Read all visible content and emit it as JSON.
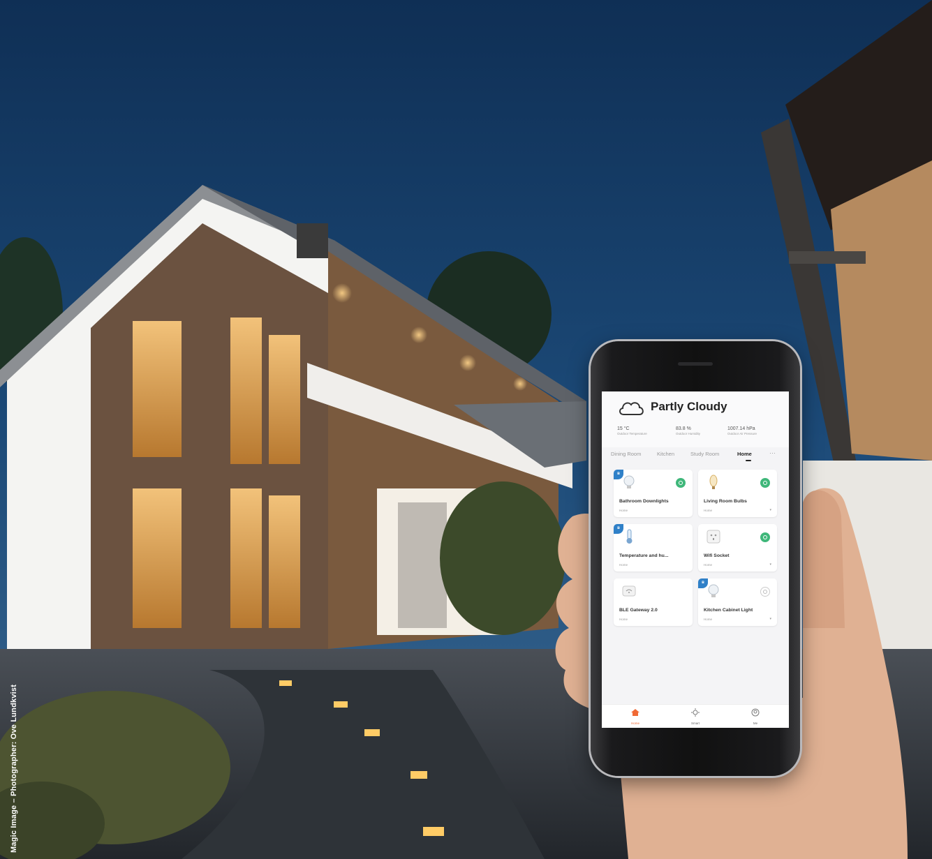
{
  "credit": "Magic Image – Photographer: Ove Lundkvist",
  "app": {
    "weather": {
      "title": "Partly Cloudy",
      "stats": [
        {
          "value": "15 °C",
          "label": "Outdoor Temperature"
        },
        {
          "value": "83.8 %",
          "label": "Outdoor Humidity"
        },
        {
          "value": "1007.14 hPa",
          "label": "Outdoor Air Pressure"
        }
      ]
    },
    "tabs": [
      "Dining Room",
      "Kitchen",
      "Study Room",
      "Home"
    ],
    "active_tab": "Home",
    "more_label": "···",
    "devices": [
      {
        "name": "Bathroom Downlights",
        "room": "Home",
        "icon": "bulb-icon",
        "state": "on",
        "ble": true
      },
      {
        "name": "Living Room Bulbs",
        "room": "Home",
        "icon": "vintage-bulb-icon",
        "state": "on",
        "ble": false
      },
      {
        "name": "Temperature and hu...",
        "room": "Home",
        "icon": "thermometer-icon",
        "state": "none",
        "ble": true
      },
      {
        "name": "Wifi Socket",
        "room": "Home",
        "icon": "socket-icon",
        "state": "on",
        "ble": false
      },
      {
        "name": "BLE Gateway 2.0",
        "room": "Home",
        "icon": "gateway-icon",
        "state": "none",
        "ble": false
      },
      {
        "name": "Kitchen Cabinet Light",
        "room": "Home",
        "icon": "bulb-icon",
        "state": "off",
        "ble": true
      }
    ],
    "nav": [
      {
        "label": "Home",
        "icon": "home-icon",
        "active": true
      },
      {
        "label": "Smart",
        "icon": "smart-icon",
        "active": false
      },
      {
        "label": "Me",
        "icon": "me-icon",
        "active": false
      }
    ],
    "accent": "#f06a35"
  }
}
